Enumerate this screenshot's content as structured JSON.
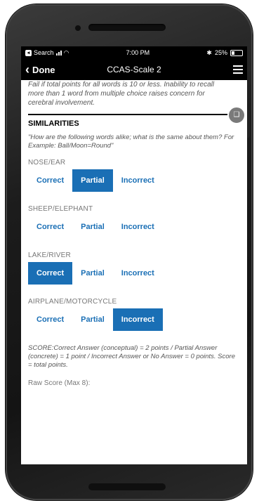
{
  "status": {
    "back_app": "Search",
    "time": "7:00 PM",
    "battery": "25%"
  },
  "nav": {
    "back_label": "Done",
    "title": "CCAS-Scale 2"
  },
  "intro_text": "Fail if total points for all words is 10 or less. Inability to recall more than 1 word from multiple choice raises concern for cerebral involvement.",
  "section": {
    "title": "SIMILARITIES",
    "prompt": "\"How are the following words alike; what is the same about them? For Example: Ball/Moon=Round\""
  },
  "options": {
    "correct": "Correct",
    "partial": "Partial",
    "incorrect": "Incorrect"
  },
  "items": [
    {
      "label": "NOSE/EAR",
      "selected": "Partial"
    },
    {
      "label": "SHEEP/ELEPHANT",
      "selected": ""
    },
    {
      "label": "LAKE/RIVER",
      "selected": "Correct"
    },
    {
      "label": "AIRPLANE/MOTORCYCLE",
      "selected": "Incorrect"
    }
  ],
  "score_text": "SCORE:Correct Answer (conceptual) = 2 points / Partial Answer (concrete) = 1 point / Incorrect Answer or No Answer = 0 points. Score = total points.",
  "raw_score_label": "Raw Score (Max 8):",
  "colors": {
    "accent": "#1a6fb5"
  },
  "icons": [
    "back-app-icon",
    "signal-icon",
    "wifi-icon",
    "menu-icon",
    "book-icon"
  ]
}
